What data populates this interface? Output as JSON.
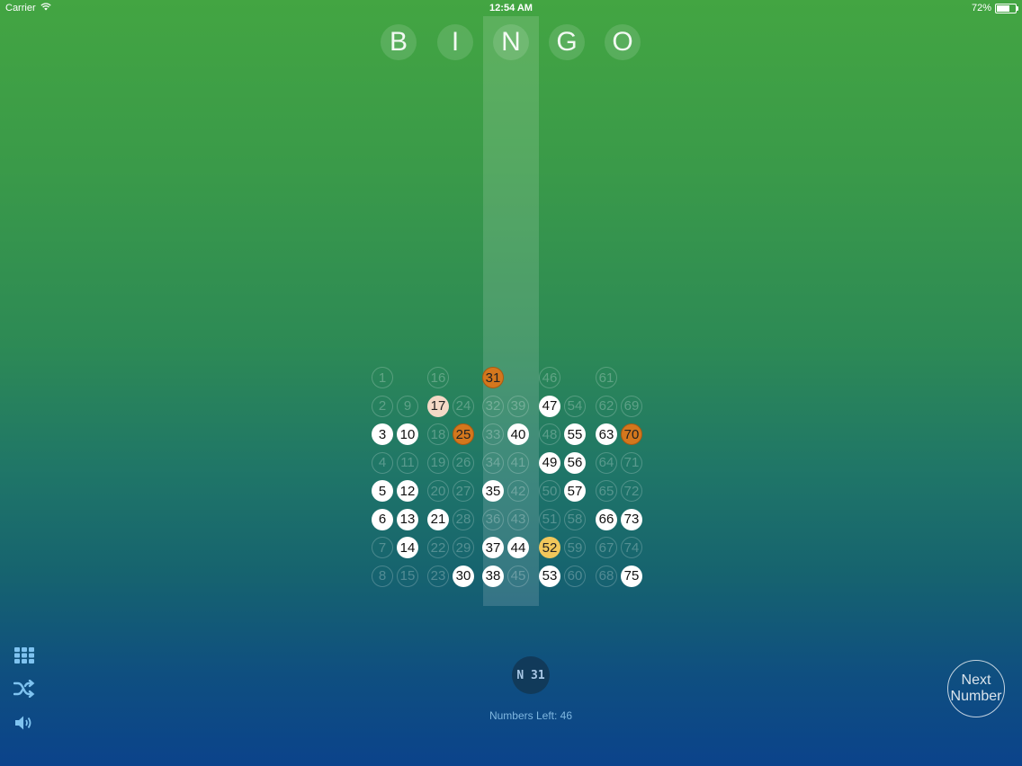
{
  "status_bar": {
    "carrier": "Carrier",
    "time": "12:54 AM",
    "battery": "72%",
    "battery_level": 0.72
  },
  "header": {
    "letters": [
      "B",
      "I",
      "N",
      "G",
      "O"
    ],
    "highlighted_column": "N"
  },
  "board": {
    "columns": [
      {
        "letter": "B",
        "numbers": [
          1,
          2,
          3,
          4,
          5,
          6,
          7,
          8,
          9,
          10,
          11,
          12,
          13,
          14,
          15
        ]
      },
      {
        "letter": "I",
        "numbers": [
          16,
          17,
          18,
          19,
          20,
          21,
          22,
          23,
          24,
          25,
          26,
          27,
          28,
          29,
          30
        ]
      },
      {
        "letter": "N",
        "numbers": [
          31,
          32,
          33,
          34,
          35,
          36,
          37,
          38,
          39,
          40,
          41,
          42,
          43,
          44,
          45
        ]
      },
      {
        "letter": "G",
        "numbers": [
          46,
          47,
          48,
          49,
          50,
          51,
          52,
          53,
          54,
          55,
          56,
          57,
          58,
          59,
          60
        ]
      },
      {
        "letter": "O",
        "numbers": [
          61,
          62,
          63,
          64,
          65,
          66,
          67,
          68,
          69,
          70,
          71,
          72,
          73,
          74,
          75
        ]
      }
    ],
    "called": [
      3,
      5,
      6,
      10,
      12,
      13,
      14,
      21,
      30,
      35,
      37,
      38,
      40,
      44,
      47,
      49,
      53,
      55,
      56,
      57,
      63,
      66,
      73,
      75
    ],
    "current": 31,
    "recent": [
      17
    ],
    "highlight_orange": [
      25,
      70
    ],
    "highlight_gold": [
      52
    ]
  },
  "controls": {
    "grid_icon": "grid-icon",
    "shuffle_icon": "shuffle-icon",
    "sound_icon": "speaker-icon",
    "current_call": "N 31",
    "numbers_left": "Numbers Left: 46",
    "next_button": "Next\nNumber"
  },
  "colors": {
    "current": "#d4771d",
    "recent": "#f4d9c6",
    "gold": "#f1c75b",
    "icon": "#7fc3f0"
  }
}
